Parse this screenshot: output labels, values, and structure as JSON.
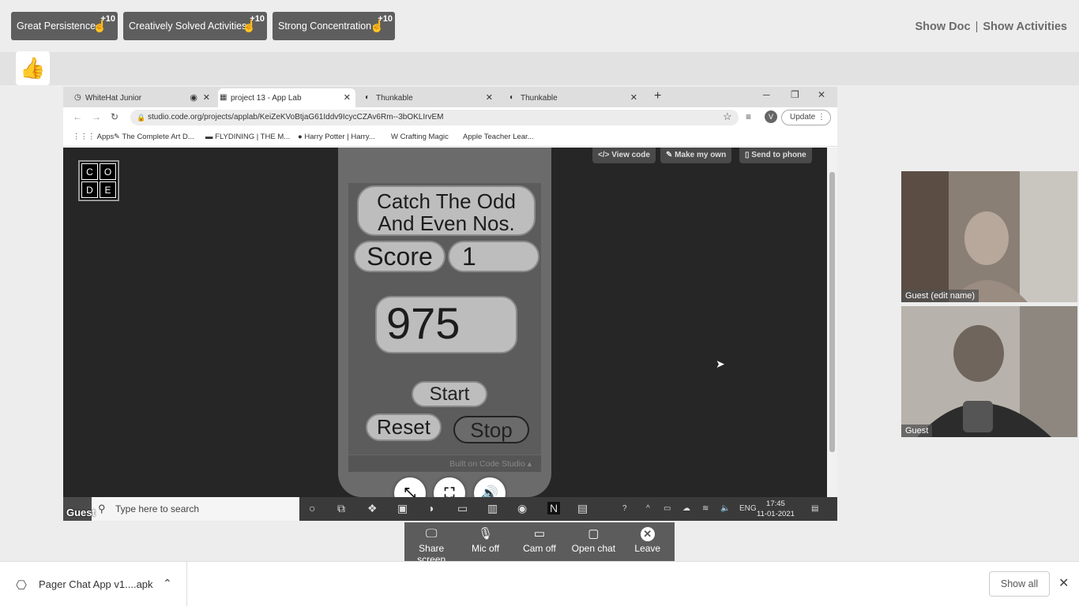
{
  "badges": [
    {
      "label": "Great Persistence",
      "points": "+10"
    },
    {
      "label": "Creatively Solved Activities",
      "points": "+10"
    },
    {
      "label": "Strong Concentration",
      "points": "+10"
    }
  ],
  "top_links": {
    "show_doc": "Show Doc",
    "separator": "|",
    "show_activities": "Show Activities"
  },
  "browser": {
    "tabs": [
      {
        "title": "WhiteHat Junior"
      },
      {
        "title": "project 13 - App Lab"
      },
      {
        "title": "Thunkable"
      },
      {
        "title": "Thunkable"
      }
    ],
    "url": "studio.code.org/projects/applab/KeiZeKVoBtjaG61Iddv9IcycCZAv6Rm--3bOKLIrvEM",
    "profile_initial": "V",
    "update_label": "Update",
    "bookmarks": [
      "Apps",
      "The Complete Art D...",
      "FLYDINING | THE M...",
      "Harry Potter | Harry...",
      "Crafting Magic",
      "Apple Teacher Lear..."
    ]
  },
  "applab": {
    "logo_letters": [
      "C",
      "O",
      "D",
      "E"
    ],
    "view_code": "</> View code",
    "make_my_own": "Make my own",
    "send_to_phone": "Send to phone",
    "title": "Catch The Odd And Even Nos.",
    "score_label": "Score",
    "score_value": "1",
    "number": "975",
    "start": "Start",
    "reset": "Reset",
    "stop": "Stop",
    "built_on": "Built on Code Studio ▴"
  },
  "taskbar": {
    "search_placeholder": "Type here to search",
    "language": "ENG",
    "time": "17:45",
    "date": "11-01-2021",
    "sharer_label": "Guest"
  },
  "videos": [
    {
      "name": "Guest (edit name)"
    },
    {
      "name": "Guest"
    }
  ],
  "controls": [
    {
      "label": "Share screen",
      "icon": "monitor-icon"
    },
    {
      "label": "Mic off",
      "icon": "mic-icon"
    },
    {
      "label": "Cam off",
      "icon": "camera-icon"
    },
    {
      "label": "Open chat",
      "icon": "chat-icon"
    },
    {
      "label": "Leave",
      "icon": "close-icon"
    }
  ],
  "downloads": {
    "filename": "Pager Chat App v1....apk",
    "show_all": "Show all"
  }
}
